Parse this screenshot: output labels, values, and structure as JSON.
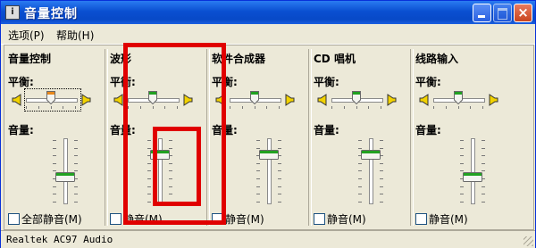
{
  "window": {
    "title": "音量控制",
    "app_icon_glyph": "i",
    "close_glyph": "×"
  },
  "menu": {
    "options": "选项(P)",
    "help": "帮助(H)"
  },
  "labels": {
    "balance": "平衡:",
    "volume": "音量:"
  },
  "columns": [
    {
      "title": "音量控制",
      "mute_label": "全部静音(M)",
      "volume_level": 0.45,
      "balance": 0.0
    },
    {
      "title": "波形",
      "mute_label": "静音(M)",
      "volume_level": 0.85,
      "balance": 0.0
    },
    {
      "title": "软件合成器",
      "mute_label": "静音(M)",
      "volume_level": 0.85,
      "balance": 0.0
    },
    {
      "title": "CD 唱机",
      "mute_label": "静音(M)",
      "volume_level": 0.85,
      "balance": 0.0
    },
    {
      "title": "线路输入",
      "mute_label": "静音(M)",
      "volume_level": 0.45,
      "balance": 0.0
    }
  ],
  "status": "Realtek AC97 Audio",
  "colors": {
    "highlight": "#e00000",
    "thumb_green": "#21a121",
    "thumb_orange": "#e8891c"
  },
  "icons": {
    "speaker_left": "speaker-left-icon",
    "speaker_right": "speaker-right-icon",
    "slider_thumb": "slider-thumb-icon"
  }
}
